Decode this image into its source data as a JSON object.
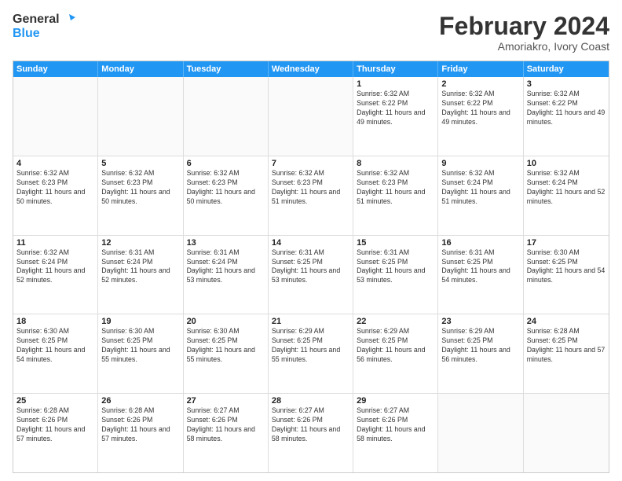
{
  "header": {
    "logo": {
      "line1": "General",
      "line2": "Blue"
    },
    "title": "February 2024",
    "subtitle": "Amoriakro, Ivory Coast"
  },
  "weekdays": [
    "Sunday",
    "Monday",
    "Tuesday",
    "Wednesday",
    "Thursday",
    "Friday",
    "Saturday"
  ],
  "rows": [
    {
      "cells": [
        {
          "empty": true
        },
        {
          "empty": true
        },
        {
          "empty": true
        },
        {
          "empty": true
        },
        {
          "day": "1",
          "sunrise": "6:32 AM",
          "sunset": "6:22 PM",
          "daylight": "11 hours and 49 minutes."
        },
        {
          "day": "2",
          "sunrise": "6:32 AM",
          "sunset": "6:22 PM",
          "daylight": "11 hours and 49 minutes."
        },
        {
          "day": "3",
          "sunrise": "6:32 AM",
          "sunset": "6:22 PM",
          "daylight": "11 hours and 49 minutes."
        }
      ]
    },
    {
      "cells": [
        {
          "day": "4",
          "sunrise": "6:32 AM",
          "sunset": "6:23 PM",
          "daylight": "11 hours and 50 minutes."
        },
        {
          "day": "5",
          "sunrise": "6:32 AM",
          "sunset": "6:23 PM",
          "daylight": "11 hours and 50 minutes."
        },
        {
          "day": "6",
          "sunrise": "6:32 AM",
          "sunset": "6:23 PM",
          "daylight": "11 hours and 50 minutes."
        },
        {
          "day": "7",
          "sunrise": "6:32 AM",
          "sunset": "6:23 PM",
          "daylight": "11 hours and 51 minutes."
        },
        {
          "day": "8",
          "sunrise": "6:32 AM",
          "sunset": "6:23 PM",
          "daylight": "11 hours and 51 minutes."
        },
        {
          "day": "9",
          "sunrise": "6:32 AM",
          "sunset": "6:24 PM",
          "daylight": "11 hours and 51 minutes."
        },
        {
          "day": "10",
          "sunrise": "6:32 AM",
          "sunset": "6:24 PM",
          "daylight": "11 hours and 52 minutes."
        }
      ]
    },
    {
      "cells": [
        {
          "day": "11",
          "sunrise": "6:32 AM",
          "sunset": "6:24 PM",
          "daylight": "11 hours and 52 minutes."
        },
        {
          "day": "12",
          "sunrise": "6:31 AM",
          "sunset": "6:24 PM",
          "daylight": "11 hours and 52 minutes."
        },
        {
          "day": "13",
          "sunrise": "6:31 AM",
          "sunset": "6:24 PM",
          "daylight": "11 hours and 53 minutes."
        },
        {
          "day": "14",
          "sunrise": "6:31 AM",
          "sunset": "6:25 PM",
          "daylight": "11 hours and 53 minutes."
        },
        {
          "day": "15",
          "sunrise": "6:31 AM",
          "sunset": "6:25 PM",
          "daylight": "11 hours and 53 minutes."
        },
        {
          "day": "16",
          "sunrise": "6:31 AM",
          "sunset": "6:25 PM",
          "daylight": "11 hours and 54 minutes."
        },
        {
          "day": "17",
          "sunrise": "6:30 AM",
          "sunset": "6:25 PM",
          "daylight": "11 hours and 54 minutes."
        }
      ]
    },
    {
      "cells": [
        {
          "day": "18",
          "sunrise": "6:30 AM",
          "sunset": "6:25 PM",
          "daylight": "11 hours and 54 minutes."
        },
        {
          "day": "19",
          "sunrise": "6:30 AM",
          "sunset": "6:25 PM",
          "daylight": "11 hours and 55 minutes."
        },
        {
          "day": "20",
          "sunrise": "6:30 AM",
          "sunset": "6:25 PM",
          "daylight": "11 hours and 55 minutes."
        },
        {
          "day": "21",
          "sunrise": "6:29 AM",
          "sunset": "6:25 PM",
          "daylight": "11 hours and 55 minutes."
        },
        {
          "day": "22",
          "sunrise": "6:29 AM",
          "sunset": "6:25 PM",
          "daylight": "11 hours and 56 minutes."
        },
        {
          "day": "23",
          "sunrise": "6:29 AM",
          "sunset": "6:25 PM",
          "daylight": "11 hours and 56 minutes."
        },
        {
          "day": "24",
          "sunrise": "6:28 AM",
          "sunset": "6:25 PM",
          "daylight": "11 hours and 57 minutes."
        }
      ]
    },
    {
      "cells": [
        {
          "day": "25",
          "sunrise": "6:28 AM",
          "sunset": "6:26 PM",
          "daylight": "11 hours and 57 minutes."
        },
        {
          "day": "26",
          "sunrise": "6:28 AM",
          "sunset": "6:26 PM",
          "daylight": "11 hours and 57 minutes."
        },
        {
          "day": "27",
          "sunrise": "6:27 AM",
          "sunset": "6:26 PM",
          "daylight": "11 hours and 58 minutes."
        },
        {
          "day": "28",
          "sunrise": "6:27 AM",
          "sunset": "6:26 PM",
          "daylight": "11 hours and 58 minutes."
        },
        {
          "day": "29",
          "sunrise": "6:27 AM",
          "sunset": "6:26 PM",
          "daylight": "11 hours and 58 minutes."
        },
        {
          "empty": true
        },
        {
          "empty": true
        }
      ]
    }
  ],
  "labels": {
    "sunrise_prefix": "Sunrise: ",
    "sunset_prefix": "Sunset: ",
    "daylight_prefix": "Daylight: "
  }
}
